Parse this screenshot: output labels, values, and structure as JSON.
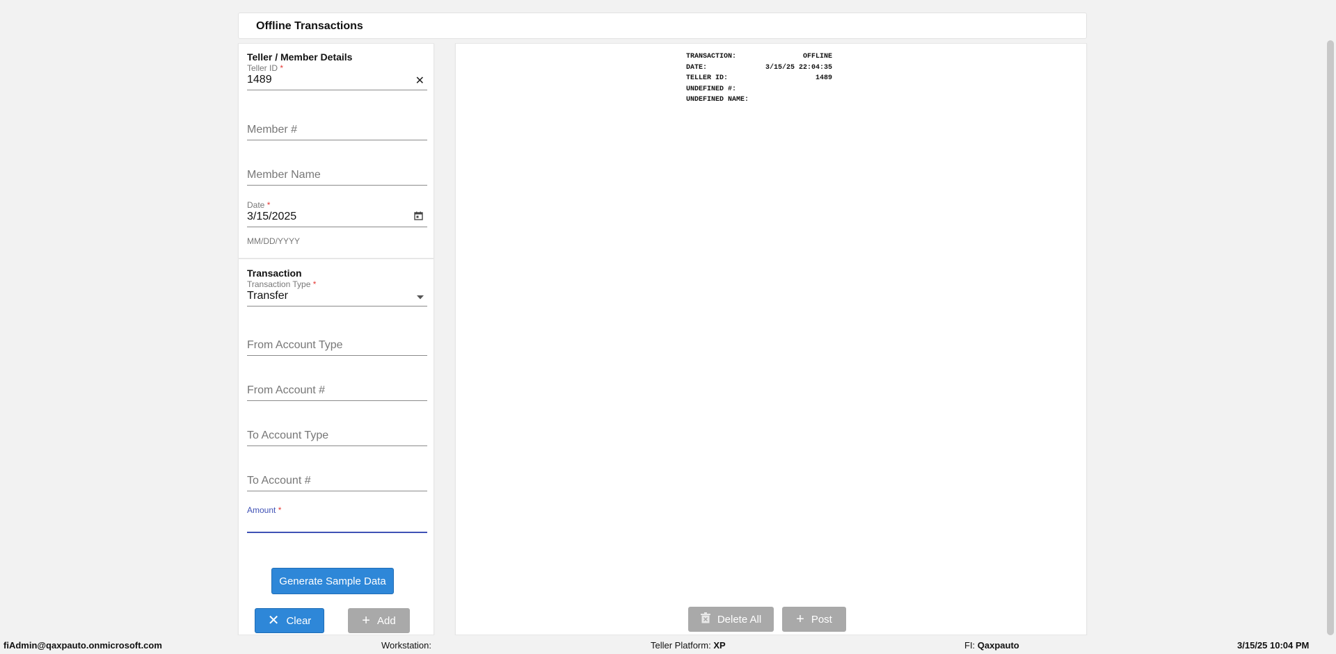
{
  "header": {
    "title": "Offline Transactions"
  },
  "member_section": {
    "title": "Teller / Member Details",
    "teller_id": {
      "label": "Teller ID",
      "required_mark": "*",
      "value": "1489",
      "clear_icon": "close-icon"
    },
    "member_number": {
      "placeholder": "Member #"
    },
    "member_name": {
      "placeholder": "Member Name"
    },
    "date": {
      "label": "Date",
      "required_mark": "*",
      "value": "3/15/2025",
      "helper": "MM/DD/YYYY",
      "icon": "calendar-icon"
    }
  },
  "transaction_section": {
    "title": "Transaction",
    "transaction_type": {
      "label": "Transaction Type",
      "required_mark": "*",
      "value": "Transfer",
      "icon": "dropdown-arrow-icon"
    },
    "from_account_type": {
      "placeholder": "From Account Type"
    },
    "from_account_number": {
      "placeholder": "From Account #"
    },
    "to_account_type": {
      "placeholder": "To Account Type"
    },
    "to_account_number": {
      "placeholder": "To Account #"
    },
    "amount": {
      "label": "Amount",
      "required_mark": "*",
      "value": ""
    }
  },
  "buttons": {
    "generate_sample": "Generate Sample Data",
    "clear": "Clear",
    "add": "Add",
    "delete_all": "Delete All",
    "post": "Post"
  },
  "receipt": {
    "rows": [
      {
        "key": "TRANSACTION:",
        "value": "OFFLINE"
      },
      {
        "key": "DATE:",
        "value": "3/15/25 22:04:35"
      },
      {
        "key": "TELLER ID:",
        "value": "1489"
      },
      {
        "key": "UNDEFINED #:",
        "value": ""
      },
      {
        "key": "UNDEFINED NAME:",
        "value": ""
      }
    ]
  },
  "status_bar": {
    "user": "fiAdmin@qaxpauto.onmicrosoft.com",
    "workstation_label": "Workstation:",
    "workstation_value": "",
    "platform_label": "Teller Platform:",
    "platform_value": "XP",
    "fi_label": "FI:",
    "fi_value": "Qaxpauto",
    "datetime": "3/15/25 10:04 PM"
  },
  "colors": {
    "primary_button": "#2e87d8",
    "disabled_button": "#a9a9a9",
    "focus_accent": "#3f51b5",
    "required": "#e53935"
  }
}
